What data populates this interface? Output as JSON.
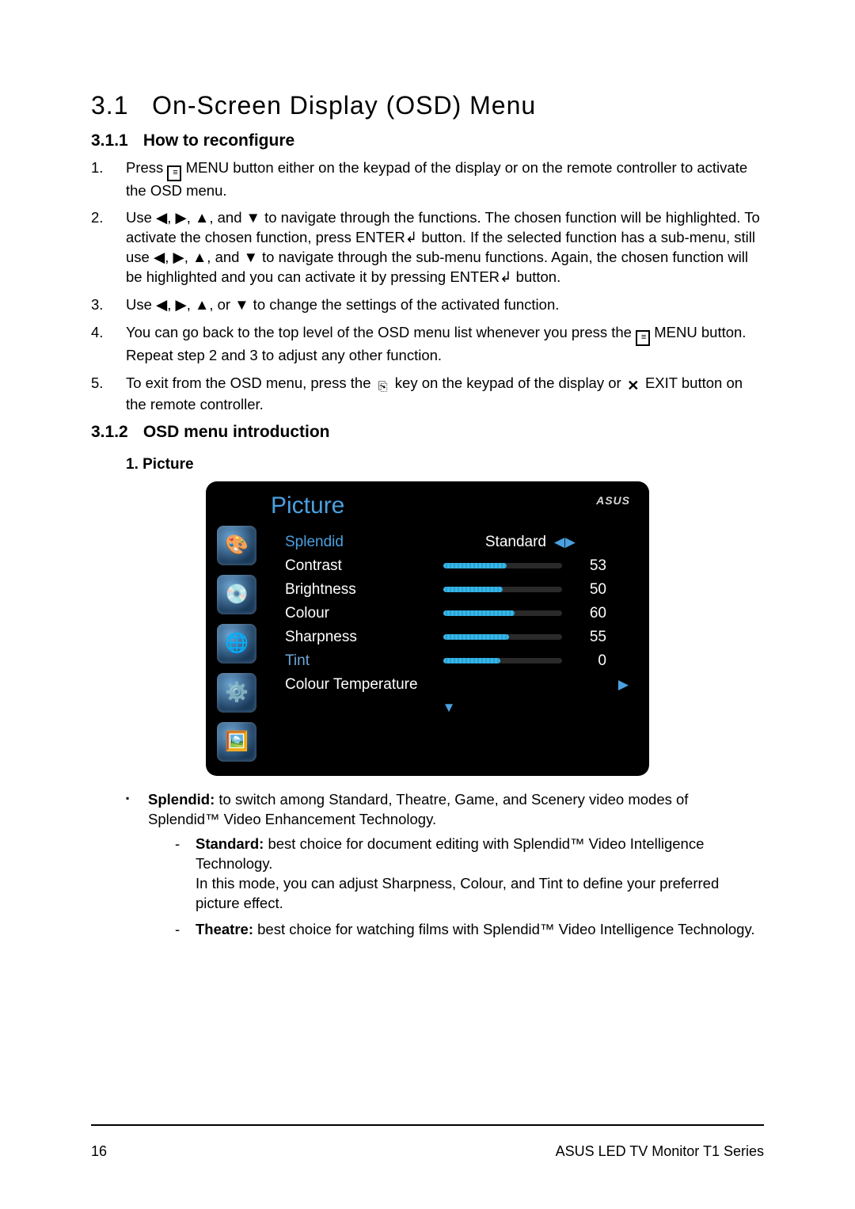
{
  "section": {
    "number": "3.1",
    "title": "On-Screen Display (OSD) Menu"
  },
  "sub311": {
    "number": "3.1.1",
    "title": "How to reconfigure"
  },
  "steps": {
    "s1a": "Press ",
    "s1b": " MENU button either on the keypad of the display or on the remote controller to activate the OSD menu.",
    "s2": "Use ◀, ▶, ▲, and ▼ to navigate through the functions. The chosen function will be highlighted. To activate the chosen function, press ENTER↲ button. If the selected function has a sub-menu, still use ◀, ▶, ▲, and ▼ to navigate through the sub-menu functions. Again, the chosen function will be highlighted and you can activate it by pressing ENTER↲ button.",
    "s3": "Use ◀, ▶, ▲, or ▼ to change the settings of the activated function.",
    "s4a": "You can go back to the top level of the OSD menu list whenever you press the ",
    "s4b": " MENU button. Repeat step 2 and 3 to adjust any other function.",
    "s5a": "To exit from the OSD menu, press the ",
    "s5b": " key on the keypad of the display or ",
    "s5c": " EXIT button on the remote controller."
  },
  "sub312": {
    "number": "3.1.2",
    "title": "OSD menu introduction"
  },
  "pictureHeading": "1.   Picture",
  "osd": {
    "brand": "ASUS",
    "title": "Picture",
    "rows": {
      "splendid": {
        "label": "Splendid",
        "value": "Standard"
      },
      "contrast": {
        "label": "Contrast",
        "value": "53",
        "pct": 53
      },
      "brightness": {
        "label": "Brightness",
        "value": "50",
        "pct": 50
      },
      "colour": {
        "label": "Colour",
        "value": "60",
        "pct": 60
      },
      "sharpness": {
        "label": "Sharpness",
        "value": "55",
        "pct": 55
      },
      "tint": {
        "label": "Tint",
        "value": "0",
        "pct": 48
      },
      "colourtemp": {
        "label": "Colour Temperature"
      }
    }
  },
  "bullets": {
    "splendid_lead": "Splendid:",
    "splendid_body": " to switch among Standard, Theatre, Game, and Scenery video modes of Splendid™ Video Enhancement Technology.",
    "standard_lead": "Standard:",
    "standard_body1": " best choice for document editing with Splendid™ Video Intelligence Technology.",
    "standard_body2": "In this mode, you can adjust Sharpness, Colour, and Tint to define your preferred picture effect.",
    "theatre_lead": "Theatre:",
    "theatre_body": " best choice for watching films with Splendid™ Video Intelligence Technology."
  },
  "footer": {
    "page": "16",
    "product": "ASUS  LED  TV  Monitor  T1  Series"
  }
}
